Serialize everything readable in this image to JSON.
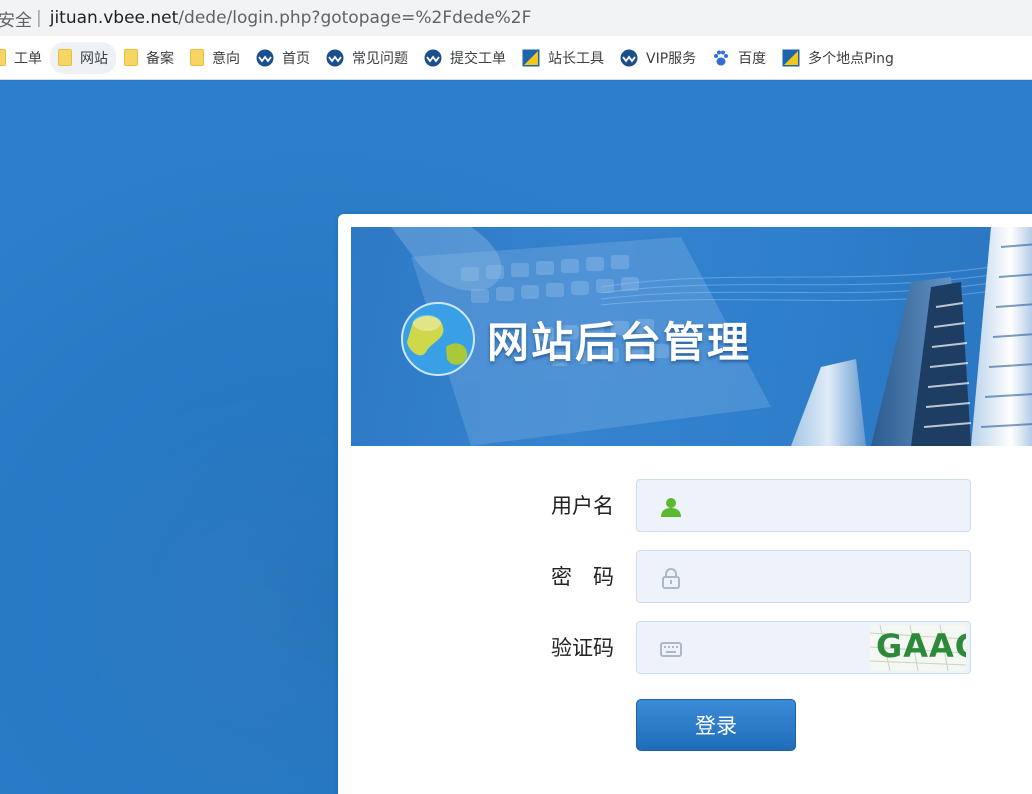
{
  "browser": {
    "security_label": "安全",
    "separator": "|",
    "url_host": "jituan.vbee.net",
    "url_path": "/dede/login.php?gotopage=%2Fdede%2F"
  },
  "bookmarks": [
    {
      "label": "工单",
      "icon": "folder-icon"
    },
    {
      "label": "网站",
      "icon": "folder-icon"
    },
    {
      "label": "备案",
      "icon": "folder-icon"
    },
    {
      "label": "意向",
      "icon": "folder-icon"
    },
    {
      "label": "首页",
      "icon": "site-favicon"
    },
    {
      "label": "常见问题",
      "icon": "site-favicon"
    },
    {
      "label": "提交工单",
      "icon": "site-favicon"
    },
    {
      "label": "站长工具",
      "icon": "chinaz-favicon"
    },
    {
      "label": "VIP服务",
      "icon": "site-favicon"
    },
    {
      "label": "百度",
      "icon": "baidu-paw-icon"
    },
    {
      "label": "多个地点Ping",
      "icon": "chinaz-favicon"
    }
  ],
  "banner": {
    "title": "网站后台管理",
    "icon": "globe-icon"
  },
  "form": {
    "username_label": "用户名",
    "password_label": "密　码",
    "captcha_label": "验证码",
    "username_value": "",
    "password_value": "",
    "captcha_value": "",
    "captcha_text": "GAAG",
    "submit_label": "登录"
  },
  "colors": {
    "page_bg": "#2a79c4",
    "button": "#2d7cc8",
    "user_icon": "#5cb82f",
    "field_bg": "#eef3fb"
  }
}
